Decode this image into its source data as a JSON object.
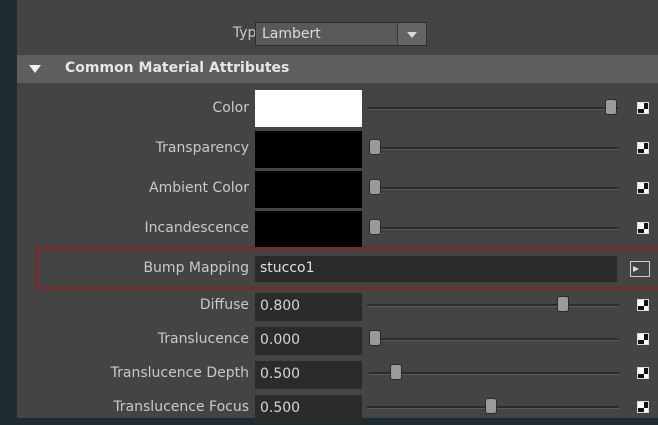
{
  "type_row": {
    "label": "Type",
    "value": "Lambert"
  },
  "section": {
    "title": "Common Material Attributes"
  },
  "color_rows": [
    {
      "label": "Color",
      "swatch": "#ffffff",
      "slider": 0.97
    },
    {
      "label": "Transparency",
      "swatch": "#000000",
      "slider": 0.0
    },
    {
      "label": "Ambient Color",
      "swatch": "#000000",
      "slider": 0.0
    },
    {
      "label": "Incandescence",
      "swatch": "#000000",
      "slider": 0.0
    }
  ],
  "bump": {
    "label": "Bump Mapping",
    "value": "stucco1",
    "highlight_color": "#8e1f1f"
  },
  "num_rows": [
    {
      "label": "Diffuse",
      "value": "0.800",
      "slider": 0.8
    },
    {
      "label": "Translucence",
      "value": "0.000",
      "slider": 0.0
    },
    {
      "label": "Translucence Depth",
      "value": "0.500",
      "slider": 0.1
    },
    {
      "label": "Translucence Focus",
      "value": "0.500",
      "slider": 0.5
    }
  ]
}
